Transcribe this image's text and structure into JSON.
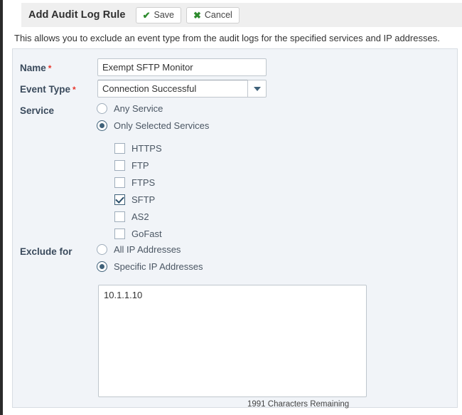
{
  "toolbar": {
    "title": "Add Audit Log Rule",
    "save_label": "Save",
    "save_icon": "check-icon",
    "cancel_label": "Cancel",
    "cancel_icon": "x-icon"
  },
  "description": "This allows you to exclude an event type from the audit logs for the specified services and IP addresses.",
  "form": {
    "name": {
      "label": "Name",
      "required_marker": "*",
      "value": "Exempt SFTP Monitor",
      "placeholder": ""
    },
    "event_type": {
      "label": "Event Type",
      "required_marker": "*",
      "value": "Connection Successful",
      "caret_icon": "chevron-down-icon"
    },
    "service": {
      "label": "Service",
      "options": [
        {
          "label": "Any Service",
          "selected": false
        },
        {
          "label": "Only Selected Services",
          "selected": true
        }
      ],
      "checkboxes": [
        {
          "label": "HTTPS",
          "checked": false
        },
        {
          "label": "FTP",
          "checked": false
        },
        {
          "label": "FTPS",
          "checked": false
        },
        {
          "label": "SFTP",
          "checked": true
        },
        {
          "label": "AS2",
          "checked": false
        },
        {
          "label": "GoFast",
          "checked": false
        }
      ]
    },
    "exclude_for": {
      "label": "Exclude for",
      "options": [
        {
          "label": "All IP Addresses",
          "selected": false
        },
        {
          "label": "Specific IP Addresses",
          "selected": true
        }
      ],
      "ip_list": {
        "value": "10.1.1.10",
        "placeholder": "",
        "characters_remaining": "1991 Characters Remaining"
      }
    }
  },
  "colors": {
    "accent": "#3f6179",
    "required": "#e8342a",
    "icon_green": "#2e8b2e",
    "panel_bg": "#f1f4f8",
    "toolbar_bg": "#efefef"
  }
}
